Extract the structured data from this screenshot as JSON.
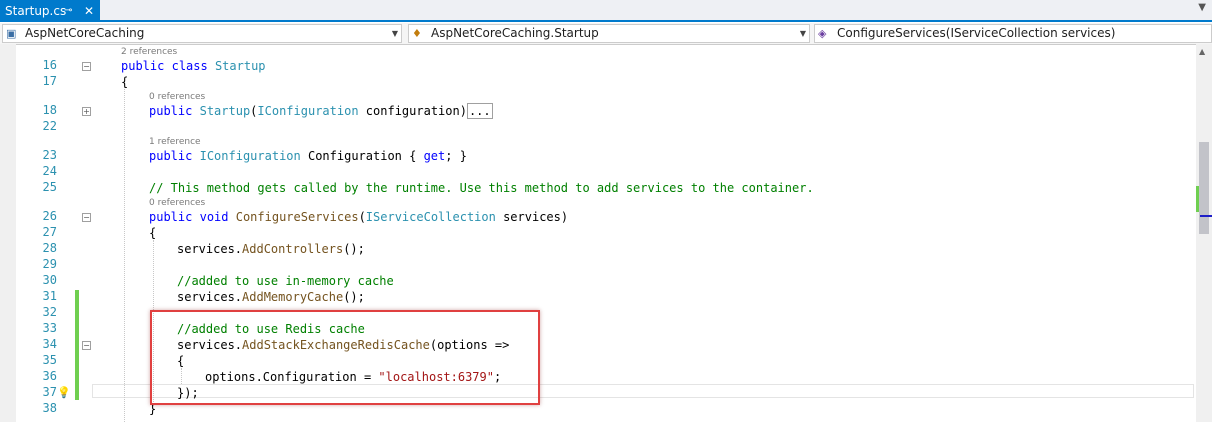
{
  "tab": {
    "title": "Startup.cs",
    "pin_glyph": "⊸",
    "close_glyph": "✕"
  },
  "navbar": {
    "project": "AspNetCoreCaching",
    "type": "AspNetCoreCaching.Startup",
    "member": "ConfigureServices(IServiceCollection services)"
  },
  "lens": {
    "refs2": "2 references",
    "refs0a": "0 references",
    "refs1": "1 reference",
    "refs0b": "0 references"
  },
  "lines": {
    "l16": "16",
    "l17": "17",
    "l18": "18",
    "l22": "22",
    "l23": "23",
    "l24": "24",
    "l25": "25",
    "l26": "26",
    "l27": "27",
    "l28": "28",
    "l29": "29",
    "l30": "30",
    "l31": "31",
    "l32": "32",
    "l33": "33",
    "l34": "34",
    "l35": "35",
    "l36": "36",
    "l37": "37",
    "l38": "38"
  },
  "code": {
    "public": "public",
    "class": "class",
    "startup": "Startup",
    "brace_open": "{",
    "brace_close": "}",
    "startup_ctor": "Startup",
    "iconfig": "IConfiguration",
    "ctor_params": "configuration)",
    "paren_open": "(",
    "ellipsis": "...",
    "config_prop": "Configuration { ",
    "get": "get",
    "prop_end": "; }",
    "comment25": "// This method gets called by the runtime. Use this method to add services to the container.",
    "void": "void",
    "configure_services": "ConfigureServices",
    "iservcoll": "IServiceCollection",
    "services_param": "services)",
    "services_dot": "services.",
    "add_controllers": "AddControllers",
    "call_end": "();",
    "comment30": "//added to use in-memory cache",
    "add_memory_cache": "AddMemoryCache",
    "comment33": "//added to use Redis cache",
    "add_redis": "AddStackExchangeRedisCache",
    "lambda": "(options =>",
    "options_config": "options.Configuration = ",
    "redis_host": "\"localhost:6379\"",
    "semicolon": ";",
    "close_lambda": "});"
  },
  "colors": {
    "keyword": "#0000ff",
    "type": "#2b91af",
    "comment": "#008000",
    "string": "#a31515",
    "accent": "#007acc",
    "highlight_box": "#e04040"
  }
}
